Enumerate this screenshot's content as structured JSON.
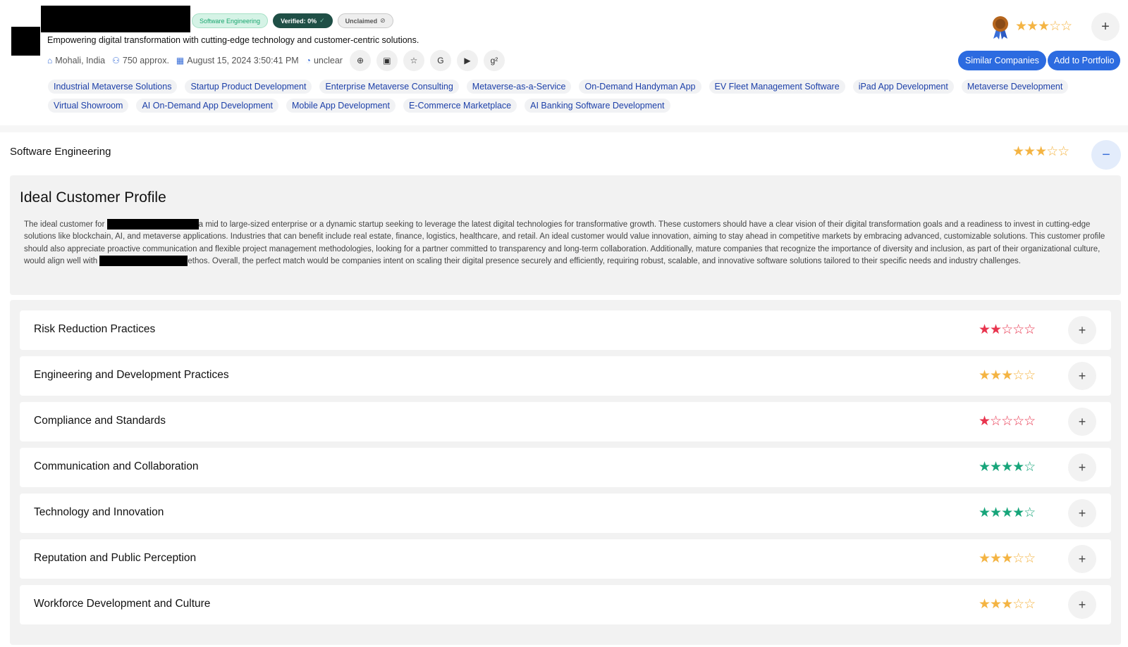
{
  "company": {
    "badges": {
      "category": "Software Engineering",
      "verified": "Verified: 0%",
      "verified_icon": "check-circle",
      "unclaimed": "Unclaimed",
      "unclaimed_icon": "check-circle"
    },
    "tagline": "Empowering digital transformation with cutting-edge technology and customer-centric solutions.",
    "meta": {
      "location": "Mohali, India",
      "employees": "750 approx.",
      "date": "August 15, 2024 3:50:41 PM",
      "status": "unclear"
    },
    "social_icons": [
      "globe-icon",
      "linkedin-icon",
      "star-icon",
      "google-icon",
      "youtube-icon",
      "clutch-icon"
    ],
    "overall_rating": 3,
    "actions": {
      "similar": "Similar Companies",
      "portfolio": "Add to Portfolio"
    },
    "tags": [
      "Industrial Metaverse Solutions",
      "Startup Product Development",
      "Enterprise Metaverse Consulting",
      "Metaverse-as-a-Service",
      "On-Demand Handyman App",
      "EV Fleet Management Software",
      "iPad App Development",
      "Metaverse Development",
      "Virtual Showroom",
      "AI On-Demand App Development",
      "Mobile App Development",
      "E-Commerce Marketplace",
      "AI Banking Software Development"
    ]
  },
  "section": {
    "title": "Software Engineering",
    "rating": 3,
    "icp": {
      "title": "Ideal Customer Profile",
      "text_part1": "The ideal customer for ",
      "text_part2": "a mid to large-sized enterprise or a dynamic startup seeking to leverage the latest digital technologies for transformative growth. These customers should have a clear vision of their digital transformation goals and a readiness to invest in cutting-edge solutions like blockchain, AI, and metaverse applications. Industries that can benefit include real estate, finance, logistics, healthcare, and retail. An ideal customer would value innovation, aiming to stay ahead in competitive markets by embracing advanced, customizable solutions. This customer profile should also appreciate proactive communication and flexible project management methodologies, looking for a partner committed to transparency and long-term collaboration. Additionally, mature companies that recognize the importance of diversity and inclusion, as part of their organizational culture, would align well with ",
      "text_part3": "ethos. Overall, the perfect match would be companies intent on scaling their digital presence securely and efficiently, requiring robust, scalable, and innovative software solutions tailored to their specific needs and industry challenges."
    },
    "categories": [
      {
        "label": "Risk Reduction Practices",
        "rating": 2,
        "color": "#e8344e"
      },
      {
        "label": "Engineering and Development Practices",
        "rating": 3,
        "color": "#f4b443"
      },
      {
        "label": "Compliance and Standards",
        "rating": 1,
        "color": "#e8344e"
      },
      {
        "label": "Communication and Collaboration",
        "rating": 4,
        "color": "#17a57a"
      },
      {
        "label": "Technology and Innovation",
        "rating": 4,
        "color": "#17a57a"
      },
      {
        "label": "Reputation and Public Perception",
        "rating": 3,
        "color": "#f4b443"
      },
      {
        "label": "Workforce Development and Culture",
        "rating": 3,
        "color": "#f4b443"
      }
    ]
  },
  "colors": {
    "accent": "#2c6be0",
    "star_gold": "#f4b443",
    "star_red": "#e8344e",
    "star_green": "#17a57a"
  }
}
